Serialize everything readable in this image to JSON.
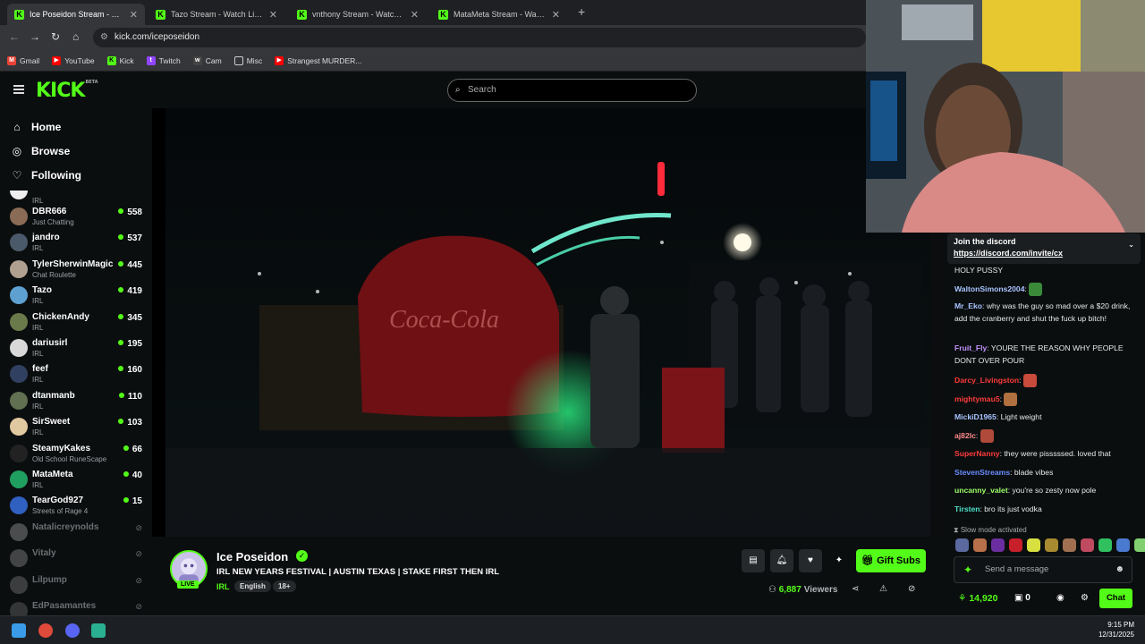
{
  "browser": {
    "tabs": [
      {
        "label": "Ice Poseidon Stream - Watch Live on Kick",
        "active": true
      },
      {
        "label": "Tazo Stream - Watch Live on Kick",
        "active": false
      },
      {
        "label": "vnthony Stream - Watch Live on Kick",
        "active": false
      },
      {
        "label": "MataMeta Stream - Watch Live on Kick",
        "active": false
      }
    ],
    "url": "kick.com/iceposeidon",
    "bookmarks": [
      {
        "label": "Gmail",
        "color": "#ea4335"
      },
      {
        "label": "YouTube",
        "color": "#ff0000"
      },
      {
        "label": "Kick",
        "color": "#53fc18"
      },
      {
        "label": "Twitch",
        "color": "#9146ff"
      },
      {
        "label": "Cam",
        "color": "#444444"
      },
      {
        "label": "Misc",
        "color": "#999999"
      },
      {
        "label": "Strangest MURDER...",
        "color": "#ff0000"
      }
    ]
  },
  "kick": {
    "logo": "KICK",
    "logo_tag": "BETA",
    "search_placeholder": "Search",
    "accent": "#53fc18"
  },
  "sidebar": {
    "nav": [
      {
        "label": "Home",
        "icon": "home-icon"
      },
      {
        "label": "Browse",
        "icon": "compass-icon"
      },
      {
        "label": "Following",
        "icon": "heart-icon"
      }
    ],
    "partial_category": "IRL",
    "channels": [
      {
        "name": "DBR666",
        "category": "Just Chatting",
        "viewers": "558",
        "live": true,
        "avatar": "#8a6b55"
      },
      {
        "name": "jandro",
        "category": "IRL",
        "viewers": "537",
        "live": true,
        "avatar": "#4a5a6a"
      },
      {
        "name": "TylerSherwinMagic",
        "category": "Chat Roulette",
        "viewers": "445",
        "live": true,
        "avatar": "#b0a090"
      },
      {
        "name": "Tazo",
        "category": "IRL",
        "viewers": "419",
        "live": true,
        "avatar": "#5ea0d0"
      },
      {
        "name": "ChickenAndy",
        "category": "IRL",
        "viewers": "345",
        "live": true,
        "avatar": "#6a7a4a"
      },
      {
        "name": "dariusirl",
        "category": "IRL",
        "viewers": "195",
        "live": true,
        "avatar": "#d8d8d8"
      },
      {
        "name": "feef",
        "category": "IRL",
        "viewers": "160",
        "live": true,
        "avatar": "#304060"
      },
      {
        "name": "dtanmanb",
        "category": "IRL",
        "viewers": "110",
        "live": true,
        "avatar": "#607050"
      },
      {
        "name": "SirSweet",
        "category": "IRL",
        "viewers": "103",
        "live": true,
        "avatar": "#e0c8a0"
      },
      {
        "name": "SteamyKakes",
        "category": "Old School RuneScape",
        "viewers": "66",
        "live": true,
        "avatar": "#222222"
      },
      {
        "name": "MataMeta",
        "category": "IRL",
        "viewers": "40",
        "live": true,
        "avatar": "#20a060"
      },
      {
        "name": "TearGod927",
        "category": "Streets of Rage 4",
        "viewers": "15",
        "live": true,
        "avatar": "#3060c0"
      },
      {
        "name": "Natalicreynolds",
        "category": "",
        "viewers": "",
        "live": false,
        "avatar": "#999999"
      },
      {
        "name": "Vitaly",
        "category": "",
        "viewers": "",
        "live": false,
        "avatar": "#888888"
      },
      {
        "name": "Lilpump",
        "category": "",
        "viewers": "",
        "live": false,
        "avatar": "#777777"
      },
      {
        "name": "EdPasamantes",
        "category": "",
        "viewers": "",
        "live": false,
        "avatar": "#666666"
      }
    ]
  },
  "stream": {
    "name": "Ice Poseidon",
    "live_badge": "LIVE",
    "title": "IRL NEW YEARS FESTIVAL | AUSTIN TEXAS | STAKE FIRST THEN IRL",
    "category": "IRL",
    "tags": [
      "English",
      "18+"
    ],
    "viewers": "6,887",
    "viewers_label": "Viewers",
    "gift_label": "Gift Subs"
  },
  "chat": {
    "discord_title": "Join the discord",
    "discord_link": "https://discord.com/invite/cx",
    "messages": [
      {
        "user": "",
        "text": "HOLY PUSSY",
        "color": "#ffffff",
        "emote": ""
      },
      {
        "user": "WaltonSimons2004",
        "text": "",
        "color": "#a9c4ff",
        "emote": "#3a8a3a"
      },
      {
        "user": "Mr_Eko",
        "text": "why was the guy so mad over a $20 drink, add the cranberry and shut the fuck up bitch!",
        "color": "#a9c4ff",
        "emote": ""
      },
      {
        "user": "Fruit_Fly",
        "text": "YOURE THE REASON WHY PEOPLE DONT OVER POUR",
        "color": "#c594ff",
        "emote": ""
      },
      {
        "user": "Darcy_Livingston",
        "text": "",
        "color": "#ff3b3b",
        "emote": "#c84a3a"
      },
      {
        "user": "mightymau5",
        "text": "",
        "color": "#ff3b3b",
        "emote": "#b07040"
      },
      {
        "user": "MickiD1965",
        "text": "Light weight",
        "color": "#a9c4ff",
        "emote": ""
      },
      {
        "user": "aj82lc",
        "text": "",
        "color": "#ff8a8a",
        "emote": "#b04a3a"
      },
      {
        "user": "SuperNanny",
        "text": "they were pisssssed. loved that",
        "color": "#ff3b3b",
        "emote": ""
      },
      {
        "user": "StevenStreams",
        "text": "blade vibes",
        "color": "#6a8cff",
        "emote": ""
      },
      {
        "user": "uncanny_valet",
        "text": "you're so zesty now pole",
        "color": "#9cff6a",
        "emote": ""
      },
      {
        "user": "Tirsten",
        "text": "bro its just vodka",
        "color": "#4fe0c8",
        "emote": ""
      }
    ],
    "slow_mode": "Slow mode activated",
    "placeholder": "Send a message",
    "points": "14,920",
    "secondary_count": "0",
    "chat_button": "Chat"
  },
  "taskbar": {
    "time": "9:15 PM",
    "date": "12/31/2025"
  }
}
